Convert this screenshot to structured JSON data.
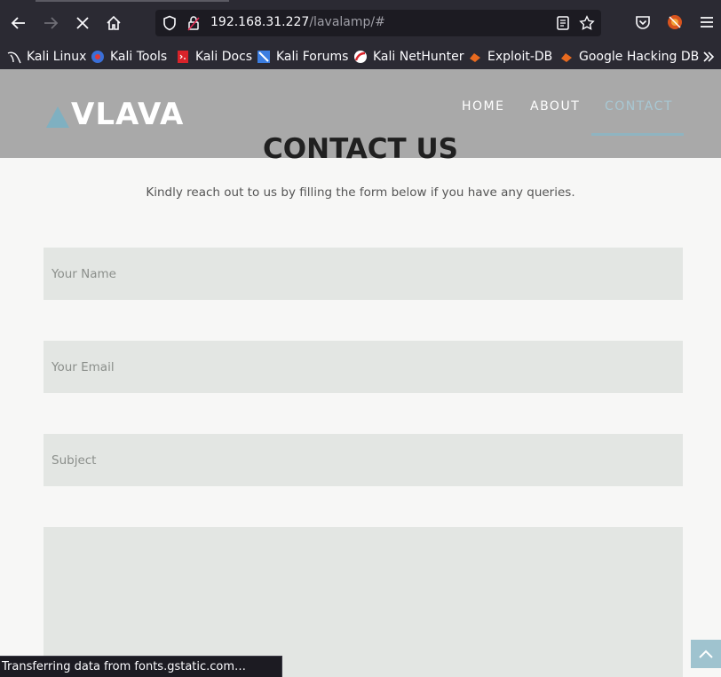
{
  "browser": {
    "url_host": "192.168.31.227",
    "url_path": "/lavalamp/#",
    "bookmarks": [
      "Kali Linux",
      "Kali Tools",
      "Kali Docs",
      "Kali Forums",
      "Kali NetHunter",
      "Exploit-DB",
      "Google Hacking DB"
    ],
    "status_text": "Transferring data from fonts.gstatic.com…"
  },
  "site": {
    "logo_text": "VLAVA",
    "nav": [
      "HOME",
      "ABOUT",
      "CONTACT"
    ],
    "active_nav": "CONTACT",
    "accent_color": "#7fb0c1"
  },
  "contact": {
    "title": "CONTACT US",
    "subtitle": "Kindly reach out to us by filling the form below if you have any queries.",
    "name_placeholder": "Your Name",
    "email_placeholder": "Your Email",
    "subject_placeholder": "Subject",
    "message_placeholder": ""
  }
}
